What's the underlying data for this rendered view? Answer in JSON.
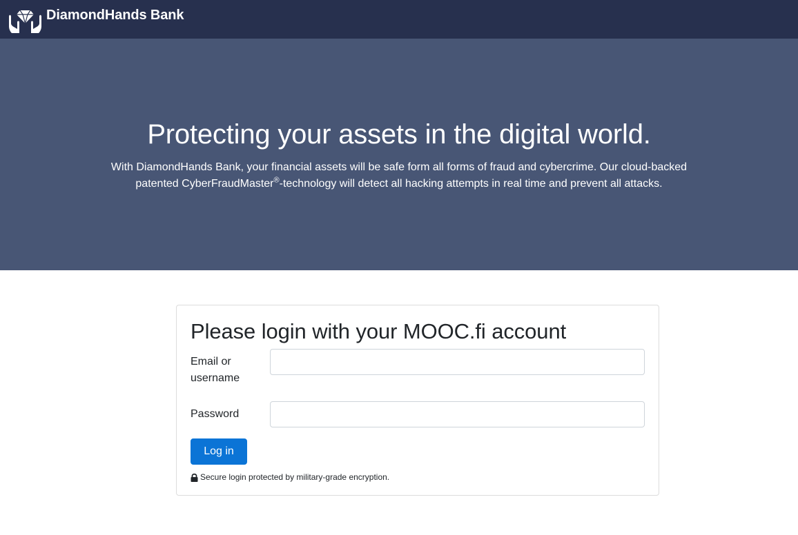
{
  "navbar": {
    "brand_name": "DiamondHands Bank",
    "logo_icon": "diamond-hands-logo-icon",
    "background": "#27304e"
  },
  "hero": {
    "title": "Protecting your assets in the digital world.",
    "text_part1": "With DiamondHands Bank, your financial assets will be safe form all forms of fraud and cybercrime. Our cloud-backed patented CyberFraudMaster",
    "trademark": "®",
    "text_part2": "-technology will detect all hacking attempts in real time and prevent all attacks.",
    "background": "#485675"
  },
  "login": {
    "title": "Please login with your MOOC.fi account",
    "email_label": "Email or username",
    "email_value": "",
    "password_label": "Password",
    "password_value": "",
    "submit_label": "Log in",
    "secure_note": "Secure login protected by military-grade encryption.",
    "lock_icon": "lock-icon",
    "accent": "#0b74d6"
  }
}
